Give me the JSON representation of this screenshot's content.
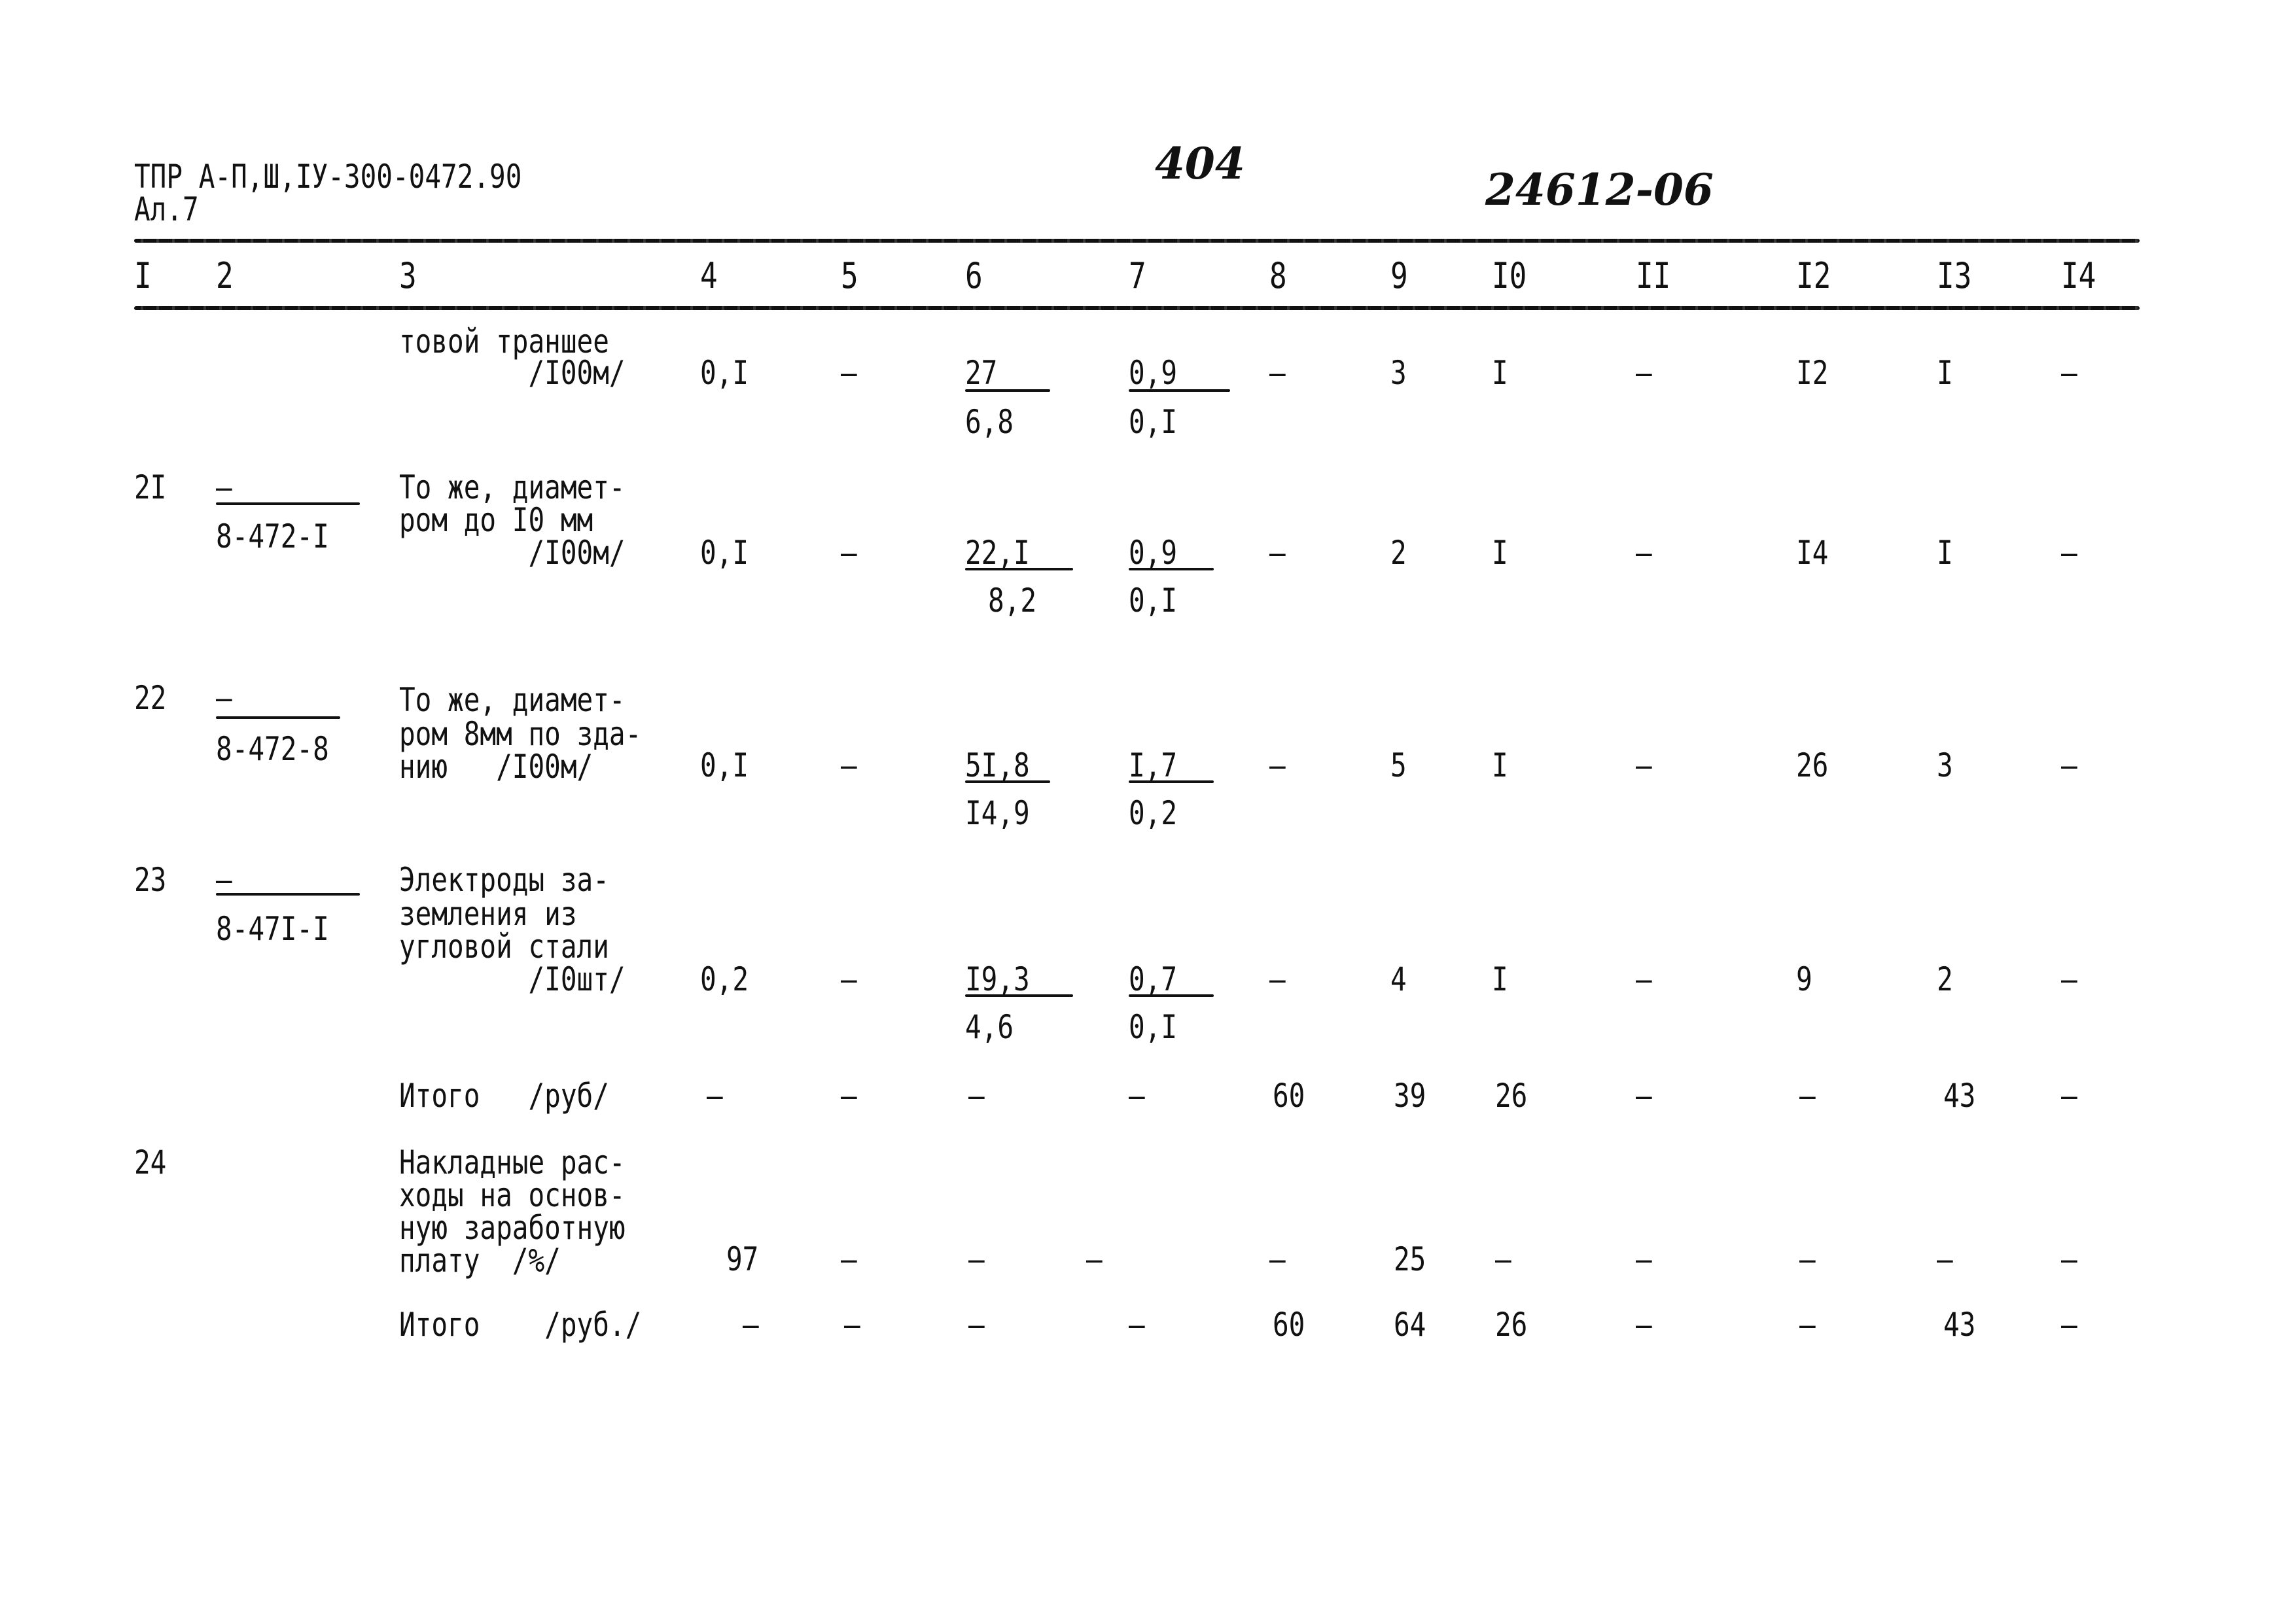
{
  "header": {
    "doc_code": "ТПР А-П,Ш,IУ-300-0472.90",
    "album": "Ал.7",
    "page_number": "404",
    "handwritten_code": "24612-06"
  },
  "columns": [
    "I",
    "2",
    "3",
    "4",
    "5",
    "6",
    "7",
    "8",
    "9",
    "I0",
    "II",
    "I2",
    "I3",
    "I4"
  ],
  "rows": [
    {
      "num": "",
      "code_top": "",
      "code_bottom": "",
      "desc": [
        "товой траншее",
        "        /I00м/"
      ],
      "c4": "0,I",
      "c5": "–",
      "c6_top": "27",
      "c6_bottom": "6,8",
      "c7_top": "0,9",
      "c7_bottom": "0,I",
      "c8": "–",
      "c9": "3",
      "c10": "I",
      "c11": "–",
      "c12": "I2",
      "c13": "I",
      "c14": "–"
    },
    {
      "num": "2I",
      "code_top": "–",
      "code_bottom": "8-472-I",
      "desc": [
        "То же, диамет-",
        "ром до I0 мм",
        "        /I00м/"
      ],
      "c4": "0,I",
      "c5": "–",
      "c6_top": "22,I",
      "c6_bottom": "8,2",
      "c7_top": "0,9",
      "c7_bottom": "0,I",
      "c8": "–",
      "c9": "2",
      "c10": "I",
      "c11": "–",
      "c12": "I4",
      "c13": "I",
      "c14": "–"
    },
    {
      "num": "22",
      "code_top": "–",
      "code_bottom": "8-472-8",
      "desc": [
        "То же, диамет-",
        "ром 8мм по зда-",
        "нию   /I00м/"
      ],
      "c4": "0,I",
      "c5": "–",
      "c6_top": "5I,8",
      "c6_bottom": "I4,9",
      "c7_top": "I,7",
      "c7_bottom": "0,2",
      "c8": "–",
      "c9": "5",
      "c10": "I",
      "c11": "–",
      "c12": "26",
      "c13": "3",
      "c14": "–"
    },
    {
      "num": "23",
      "code_top": "–",
      "code_bottom": "8-47I-I",
      "desc": [
        "Электроды за-",
        "земления из",
        "угловой стали",
        "        /I0шт/"
      ],
      "c4": "0,2",
      "c5": "–",
      "c6_top": "I9,3",
      "c6_bottom": "4,6",
      "c7_top": "0,7",
      "c7_bottom": "0,I",
      "c8": "–",
      "c9": "4",
      "c10": "I",
      "c11": "–",
      "c12": "9",
      "c13": "2",
      "c14": "–"
    }
  ],
  "total_1": {
    "label": "Итого   /руб/",
    "values": [
      "–",
      "–",
      "–",
      "–",
      "60",
      "39",
      "26",
      "–",
      "–",
      "43",
      "–"
    ]
  },
  "row_24": {
    "num": "24",
    "desc": [
      "Накладные рас-",
      "ходы на основ-",
      "ную заработную",
      "плату  /%/"
    ],
    "values": [
      "97",
      "–",
      "–",
      "–",
      "–",
      "25",
      "–",
      "–",
      "–",
      "–",
      "–"
    ]
  },
  "total_2": {
    "label": "Итого    /руб./",
    "values": [
      "–",
      "–",
      "–",
      "–",
      "60",
      "64",
      "26",
      "–",
      "–",
      "43",
      "–"
    ]
  }
}
